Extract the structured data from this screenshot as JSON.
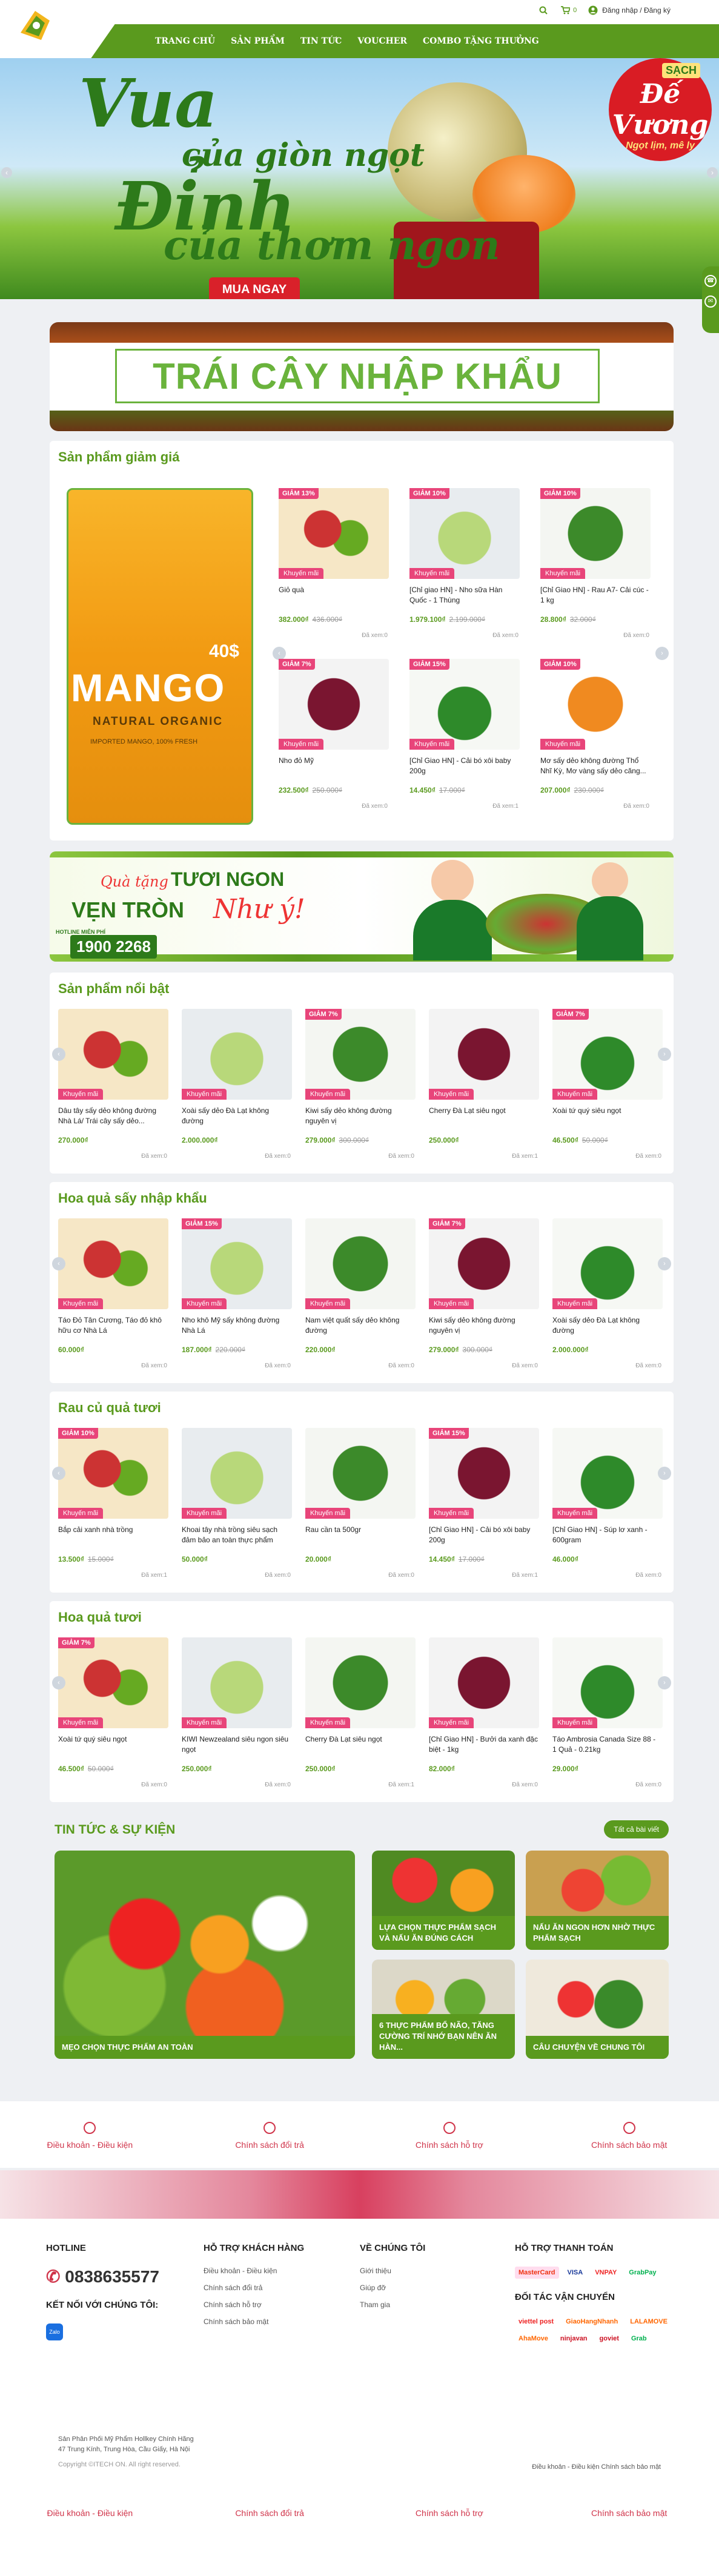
{
  "header": {
    "nav": [
      "TRANG CHỦ",
      "SẢN PHẨM",
      "TIN TỨC",
      "VOUCHER",
      "COMBO TẶNG THƯỞNG"
    ],
    "cart_count": "0",
    "user_link": "Đăng nhập / Đăng ký"
  },
  "hero": {
    "line1": "Vua",
    "line2": "của giòn ngọt",
    "line3": "Đỉnh",
    "line4": "của thơm ngon",
    "button": "MUA NGAY",
    "badge_title": "Đế Vương",
    "badge_sub": "Ngọt lịm, mê ly",
    "badge_tag": "SẠCH"
  },
  "import_banner": {
    "title": "TRÁI CÂY NHẬP KHẨU"
  },
  "discount_section": {
    "title": "Sản phẩm giảm giá",
    "mango_ad": {
      "big": "MANGO",
      "sub": "NATURAL ORGANIC",
      "price": "40$",
      "tag": "IMPORTED MANGO, 100% FRESH"
    },
    "products": [
      {
        "disc": "GIẢM 13%",
        "name": "Giỏ quà",
        "price": "382.000₫",
        "old": "436.000₫",
        "sold": "Đã xem:0"
      },
      {
        "disc": "GIẢM 10%",
        "name": "[Chỉ giao HN] - Nho sữa Hàn Quốc - 1 Thùng",
        "price": "1.979.100₫",
        "old": "2.199.000₫",
        "sold": "Đã xem:0"
      },
      {
        "disc": "GIẢM 10%",
        "name": "[Chỉ Giao HN] - Rau A7- Cải cúc - 1 kg",
        "price": "28.800₫",
        "old": "32.000₫",
        "sold": "Đã xem:0"
      },
      {
        "disc": "GIẢM 7%",
        "name": "Nho đỏ Mỹ",
        "price": "232.500₫",
        "old": "250.000₫",
        "sold": "Đã xem:0"
      },
      {
        "disc": "GIẢM 15%",
        "name": "[Chỉ Giao HN] - Cải bó xôi baby 200g",
        "price": "14.450₫",
        "old": "17.000₫",
        "sold": "Đã xem:1"
      },
      {
        "disc": "GIẢM 10%",
        "name": "Mơ sấy dẻo không đường Thổ Nhĩ Kỳ, Mơ vàng sấy dẻo căng...",
        "price": "207.000₫",
        "old": "230.000₫",
        "sold": "Đã xem:0"
      }
    ]
  },
  "promo_banner": {
    "q1": "Quà tặng",
    "q2": "TƯƠI NGON",
    "q3": "VẸN TRÒN",
    "q4": "Như ý!",
    "hotline_label": "HOTLINE MIỄN PHÍ",
    "hotline": "1900 2268"
  },
  "featured_section": {
    "title": "Sản phẩm nổi bật",
    "products": [
      {
        "disc": "",
        "name": "Dâu tây sấy dẻo không đường Nhà Lá/ Trái cây sấy dẻo...",
        "price": "270.000₫",
        "old": "",
        "sold": "Đã xem:0"
      },
      {
        "disc": "",
        "name": "Xoài sấy dẻo Đà Lạt không đường",
        "price": "2.000.000₫",
        "old": "",
        "sold": "Đã xem:0"
      },
      {
        "disc": "GIẢM 7%",
        "name": "Kiwi sấy dẻo không đường nguyên vị",
        "price": "279.000₫",
        "old": "300.000₫",
        "sold": "Đã xem:0"
      },
      {
        "disc": "",
        "name": "Cherry Đà Lạt siêu ngọt",
        "price": "250.000₫",
        "old": "",
        "sold": "Đã xem:1"
      },
      {
        "disc": "GIẢM 7%",
        "name": "Xoài tứ quý siêu ngọt",
        "price": "46.500₫",
        "old": "50.000₫",
        "sold": "Đã xem:0"
      }
    ]
  },
  "dried_section": {
    "title": "Hoa quả sấy nhập khẩu",
    "products": [
      {
        "disc": "",
        "name": "Táo Đỏ Tân Cương, Táo đỏ khô hữu cơ Nhà Lá",
        "price": "60.000₫",
        "old": "",
        "sold": "Đã xem:0"
      },
      {
        "disc": "GIẢM 15%",
        "name": "Nho khô Mỹ sấy không đường Nhà Lá",
        "price": "187.000₫",
        "old": "220.000₫",
        "sold": "Đã xem:0"
      },
      {
        "disc": "",
        "name": "Nam việt quất sấy dẻo không đường",
        "price": "220.000₫",
        "old": "",
        "sold": "Đã xem:0"
      },
      {
        "disc": "GIẢM 7%",
        "name": "Kiwi sấy dẻo không đường nguyên vị",
        "price": "279.000₫",
        "old": "300.000₫",
        "sold": "Đã xem:0"
      },
      {
        "disc": "",
        "name": "Xoài sấy dẻo Đà Lạt không đường",
        "price": "2.000.000₫",
        "old": "",
        "sold": "Đã xem:0"
      }
    ]
  },
  "veg_section": {
    "title": "Rau củ quả tươi",
    "products": [
      {
        "disc": "GIẢM 10%",
        "name": "Bắp cải xanh nhà trồng",
        "price": "13.500₫",
        "old": "15.000₫",
        "sold": "Đã xem:1"
      },
      {
        "disc": "",
        "name": "Khoai tây nhà trồng siêu sạch đảm bảo an toàn thực phẩm",
        "price": "50.000₫",
        "old": "",
        "sold": "Đã xem:0"
      },
      {
        "disc": "",
        "name": "Rau cần ta 500gr",
        "price": "20.000₫",
        "old": "",
        "sold": "Đã xem:0"
      },
      {
        "disc": "GIẢM 15%",
        "name": "[Chỉ Giao HN] - Cải bó xôi baby 200g",
        "price": "14.450₫",
        "old": "17.000₫",
        "sold": "Đã xem:1"
      },
      {
        "disc": "",
        "name": "[Chỉ Giao HN] - Súp lơ xanh - 600gram",
        "price": "46.000₫",
        "old": "",
        "sold": "Đã xem:0"
      }
    ]
  },
  "fruit_section": {
    "title": "Hoa quả tươi",
    "products": [
      {
        "disc": "GIẢM 7%",
        "name": "Xoài tứ quý siêu ngọt",
        "price": "46.500₫",
        "old": "50.000₫",
        "sold": "Đã xem:0"
      },
      {
        "disc": "",
        "name": "KIWI Newzealand siêu ngon siêu ngọt",
        "price": "250.000₫",
        "old": "",
        "sold": "Đã xem:0"
      },
      {
        "disc": "",
        "name": "Cherry Đà Lạt siêu ngọt",
        "price": "250.000₫",
        "old": "",
        "sold": "Đã xem:1"
      },
      {
        "disc": "",
        "name": "[Chỉ Giao HN] - Bưởi da xanh đặc biệt - 1kg",
        "price": "82.000₫",
        "old": "",
        "sold": "Đã xem:0"
      },
      {
        "disc": "",
        "name": "Táo Ambrosia Canada Size 88 - 1 Quả - 0.21kg",
        "price": "29.000₫",
        "old": "",
        "sold": "Đã xem:0"
      }
    ]
  },
  "promo_label": "Khuyến mãi",
  "news": {
    "title": "TIN TỨC & SỰ KIỆN",
    "all": "Tất cả bài viết",
    "big": "MẸO CHỌN THỰC PHẨM AN TOÀN",
    "items": [
      "LỰA CHỌN THỰC PHẨM SẠCH VÀ NẤU ĂN ĐÚNG CÁCH",
      "NẤU ĂN NGON HƠN NHỜ THỰC PHẨM SẠCH",
      "6 THỰC PHẨM BỔ NÃO, TĂNG CƯỜNG TRÍ NHỚ BẠN NÊN ĂN HÀN...",
      "CÂU CHUYỆN VỀ CHUNG TÔI"
    ]
  },
  "policies": [
    "Điều khoản - Điều kiện",
    "Chính sách đổi trả",
    "Chính sách hỗ trợ",
    "Chính sách bảo mật"
  ],
  "footer": {
    "hotline_title": "HOTLINE",
    "hotline": "0838635577",
    "connect_title": "KẾT NỐI VỚI CHÚNG TÔI:",
    "support_title": "HỖ TRỢ KHÁCH HÀNG",
    "support_links": [
      "Điều khoản - Điều kiện",
      "Chính sách đổi trả",
      "Chính sách hỗ trợ",
      "Chính sách bảo mật"
    ],
    "about_title": "VỀ CHÚNG TÔI",
    "about_links": [
      "Giới thiệu",
      "Giúp đỡ",
      "Tham gia"
    ],
    "payment_title": "HỖ TRỢ THANH TOÁN",
    "payments": [
      "MasterCard",
      "VISA",
      "VNPAY",
      "GrabPay"
    ],
    "shipping_title": "ĐỐI TÁC VẬN CHUYỂN",
    "shippers": [
      "viettel post",
      "GiaoHangNhanh",
      "LALAMOVE",
      "AhaMove",
      "ninjavan",
      "goviet",
      "Grab"
    ],
    "company": "Sản Phân Phối Mỹ Phẩm Hollkey Chính Hãng",
    "address": "47 Trung Kính, Trung Hòa, Cầu Giấy, Hà Nội",
    "copyright": "Copyright ©ITECH ON. All right reserved.",
    "bottom_links": "Điều khoản - Điều kiện Chính sách bảo mật"
  }
}
